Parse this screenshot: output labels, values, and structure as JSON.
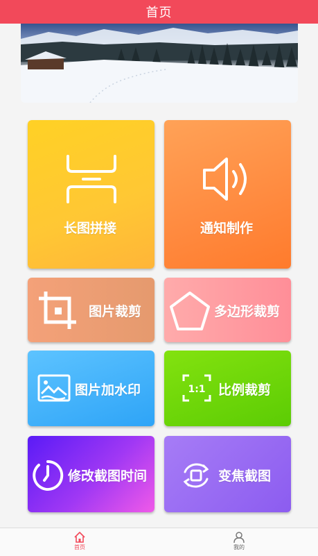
{
  "header": {
    "title": "首页"
  },
  "tiles": [
    {
      "label": "长图拼接",
      "icon": "long-image-stitch-icon"
    },
    {
      "label": "通知制作",
      "icon": "speaker-icon"
    },
    {
      "label": "图片裁剪",
      "icon": "crop-icon"
    },
    {
      "label": "多边形裁剪",
      "icon": "pentagon-icon"
    },
    {
      "label": "图片加水印",
      "icon": "image-watermark-icon"
    },
    {
      "label": "比例裁剪",
      "icon": "ratio-crop-icon"
    },
    {
      "label": "修改截图时间",
      "icon": "clock-icon"
    },
    {
      "label": "变焦截图",
      "icon": "zoom-rotate-icon"
    }
  ],
  "tabbar": {
    "home_label": "首页",
    "mine_label": "我的",
    "active_color": "#f2495a"
  },
  "colors": {
    "header": "#f2495a"
  }
}
